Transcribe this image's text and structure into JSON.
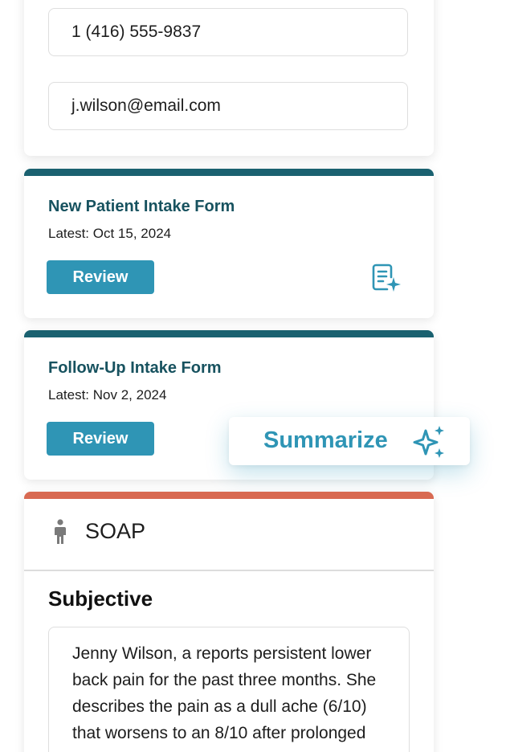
{
  "contact": {
    "phone": "1 (416) 555-9837",
    "email": "j.wilson@email.com"
  },
  "forms": [
    {
      "title": "New Patient Intake Form",
      "latest": "Latest: Oct 15, 2024",
      "review_label": "Review",
      "icon": "document-sparkle-icon"
    },
    {
      "title": "Follow-Up Intake Form",
      "latest": "Latest: Nov 2, 2024",
      "review_label": "Review"
    }
  ],
  "summarize": {
    "label": "Summarize",
    "icon": "sparkle-icon"
  },
  "soap": {
    "title": "SOAP",
    "icon": "person-icon",
    "section_heading": "Subjective",
    "subjective_text": "Jenny Wilson, a reports persistent lower back pain for the past three months. She describes the pain as a dull ache (6/10) that worsens to an 8/10 after prolonged sitting or standing."
  },
  "colors": {
    "teal_dark": "#1a6170",
    "teal_title": "#17525f",
    "button_blue": "#2f95b5",
    "soap_accent": "#d86a52"
  }
}
